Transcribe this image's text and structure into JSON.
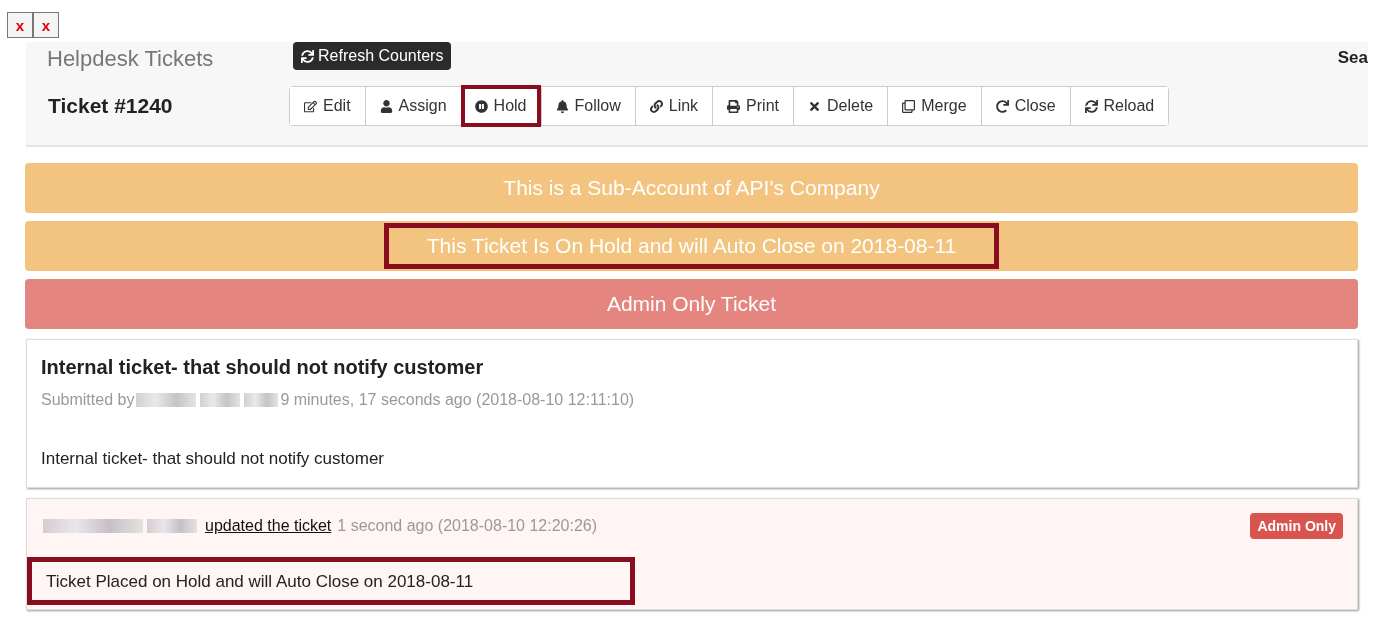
{
  "broken_images": [
    {
      "alt": "x"
    },
    {
      "alt": "x"
    }
  ],
  "header": {
    "title": "Helpdesk Tickets",
    "tooltip": "Refresh Counters",
    "search_label": "Sea",
    "ticket": "Ticket #1240",
    "buttons": [
      {
        "label": "Edit",
        "highlighted": false
      },
      {
        "label": "Assign",
        "highlighted": false
      },
      {
        "label": "Hold",
        "highlighted": true
      },
      {
        "label": "Follow",
        "highlighted": false
      },
      {
        "label": "Link",
        "highlighted": false
      },
      {
        "label": "Print",
        "highlighted": false
      },
      {
        "label": "Delete",
        "highlighted": false
      },
      {
        "label": "Merge",
        "highlighted": false
      },
      {
        "label": "Close",
        "highlighted": false
      },
      {
        "label": "Reload",
        "highlighted": false
      }
    ]
  },
  "banners": [
    {
      "text": "This is a Sub-Account of API's Company",
      "kind": "warning",
      "highlighted": false
    },
    {
      "text": "This Ticket Is On Hold and will Auto Close on 2018-08-11",
      "kind": "warning",
      "highlighted": true
    },
    {
      "text": "Admin Only Ticket",
      "kind": "danger",
      "highlighted": false
    }
  ],
  "ticket": {
    "subject": "Internal ticket- that should not notify customer",
    "submitted_by": "Submitted by",
    "age": "9 minutes, 17 seconds ago (2018-08-10 12:11:10)",
    "body": "Internal ticket- that should not notify customer"
  },
  "activity": {
    "link": "updated the ticket",
    "age": "1 second ago (2018-08-10 12:20:26)",
    "badge": "Admin Only",
    "body": "Ticket Placed on Hold and will Auto Close on 2018-08-11",
    "highlighted": true
  }
}
